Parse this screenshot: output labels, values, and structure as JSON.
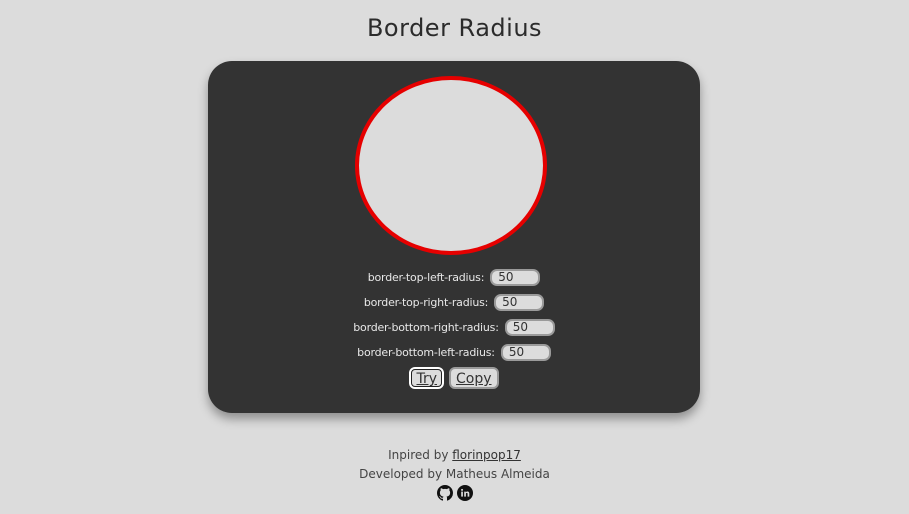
{
  "page": {
    "title": "Border Radius"
  },
  "preview": {
    "border_color": "#e60000",
    "background": "#dcdcdc"
  },
  "fields": [
    {
      "label": "border-top-left-radius:",
      "value": "50"
    },
    {
      "label": "border-top-right-radius:",
      "value": "50"
    },
    {
      "label": "border-bottom-right-radius:",
      "value": "50"
    },
    {
      "label": "border-bottom-left-radius:",
      "value": "50"
    }
  ],
  "buttons": {
    "try_label": "Try",
    "copy_label": "Copy"
  },
  "footer": {
    "inspired_prefix": "Inpired by ",
    "inspired_link": "florinpop17",
    "developed_by": "Developed by Matheus Almeida",
    "icons": [
      "github-icon",
      "linkedin-icon"
    ]
  },
  "colors": {
    "page_bg": "#dcdcdc",
    "card_bg": "#333333",
    "accent": "#e60000"
  }
}
